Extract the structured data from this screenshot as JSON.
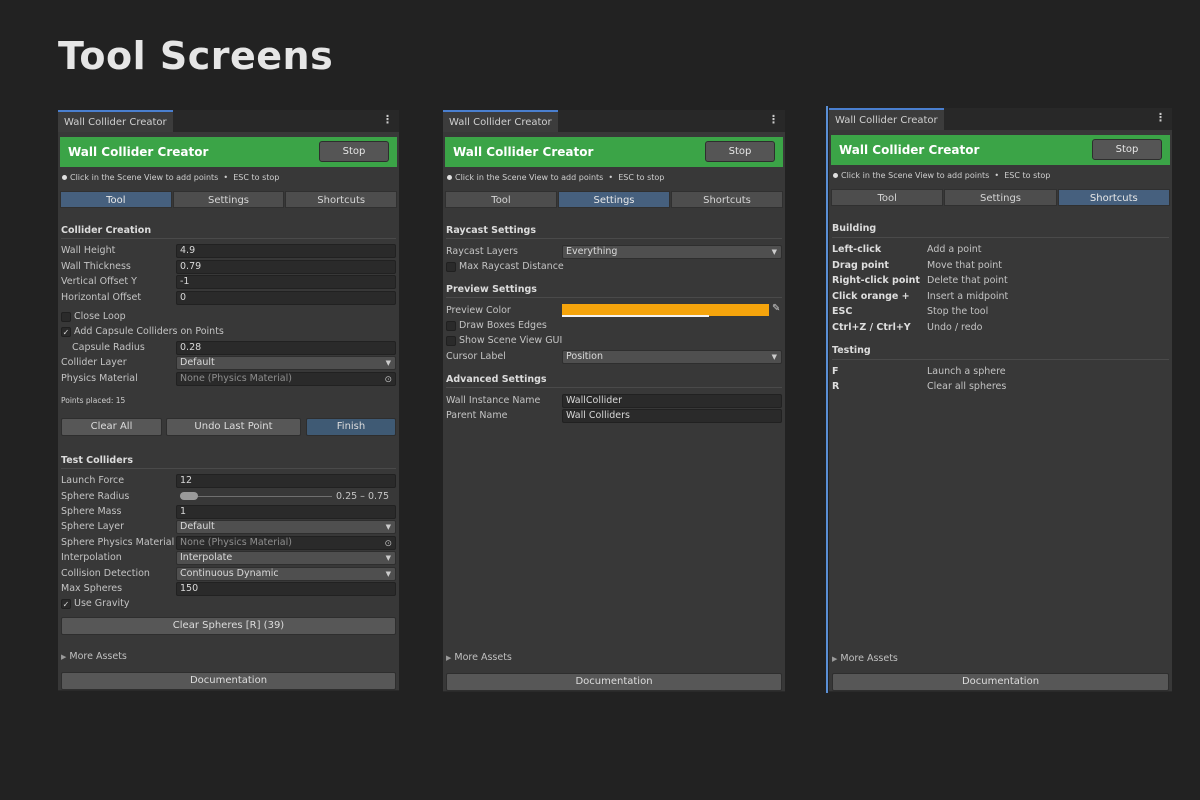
{
  "page": {
    "title": "Tool Screens"
  },
  "common": {
    "window_tab": "Wall Collider Creator",
    "header_title": "Wall Collider Creator",
    "stop_label": "Stop",
    "hint_a": "Click in the Scene View to add points",
    "hint_sep": "•",
    "hint_b": "ESC to stop",
    "tabs": [
      "Tool",
      "Settings",
      "Shortcuts"
    ],
    "more_assets": "More Assets",
    "documentation": "Documentation"
  },
  "tool": {
    "collider_creation": "Collider Creation",
    "wall_height_label": "Wall Height",
    "wall_height": "4.9",
    "wall_thickness_label": "Wall Thickness",
    "wall_thickness": "0.79",
    "vertical_offset_label": "Vertical Offset Y",
    "vertical_offset": "-1",
    "horizontal_offset_label": "Horizontal Offset",
    "horizontal_offset": "0",
    "close_loop_label": "Close Loop",
    "close_loop": false,
    "add_capsule_label": "Add Capsule Colliders on Points",
    "add_capsule": true,
    "capsule_radius_label": "Capsule Radius",
    "capsule_radius": "0.28",
    "collider_layer_label": "Collider Layer",
    "collider_layer": "Default",
    "physics_material_label": "Physics Material",
    "physics_material": "None (Physics Material)",
    "points_placed": "Points placed: 15",
    "clear_all": "Clear All",
    "undo_last": "Undo Last Point",
    "finish": "Finish",
    "test_colliders": "Test Colliders",
    "launch_force_label": "Launch Force",
    "launch_force": "12",
    "sphere_radius_label": "Sphere Radius",
    "sphere_radius": "0.25 – 0.75",
    "sphere_mass_label": "Sphere Mass",
    "sphere_mass": "1",
    "sphere_layer_label": "Sphere Layer",
    "sphere_layer": "Default",
    "sphere_material_label": "Sphere Physics Material",
    "sphere_material": "None (Physics Material)",
    "interpolation_label": "Interpolation",
    "interpolation": "Interpolate",
    "collision_label": "Collision Detection",
    "collision": "Continuous Dynamic",
    "max_spheres_label": "Max Spheres",
    "max_spheres": "150",
    "use_gravity_label": "Use Gravity",
    "use_gravity": true,
    "clear_spheres": "Clear Spheres [R] (39)"
  },
  "settings": {
    "raycast_settings": "Raycast Settings",
    "raycast_layers_label": "Raycast Layers",
    "raycast_layers": "Everything",
    "max_raycast_label": "Max Raycast Distance",
    "max_raycast": false,
    "preview_settings": "Preview Settings",
    "preview_color_label": "Preview Color",
    "preview_color": "#f5a40c",
    "draw_boxes_label": "Draw Boxes Edges",
    "draw_boxes": false,
    "show_gui_label": "Show Scene View GUI",
    "show_gui": false,
    "cursor_label_label": "Cursor Label",
    "cursor_label": "Position",
    "advanced_settings": "Advanced Settings",
    "wall_instance_label": "Wall Instance Name",
    "wall_instance": "WallCollider",
    "parent_name_label": "Parent Name",
    "parent_name": "Wall Colliders"
  },
  "shortcuts": {
    "building": "Building",
    "building_items": [
      {
        "key": "Left-click",
        "desc": "Add a point"
      },
      {
        "key": "Drag point",
        "desc": "Move that point"
      },
      {
        "key": "Right-click point",
        "desc": "Delete that point"
      },
      {
        "key": "Click orange +",
        "desc": "Insert a midpoint"
      },
      {
        "key": "ESC",
        "desc": "Stop the tool"
      },
      {
        "key": "Ctrl+Z / Ctrl+Y",
        "desc": "Undo / redo"
      }
    ],
    "testing": "Testing",
    "testing_items": [
      {
        "key": "F",
        "desc": "Launch a sphere"
      },
      {
        "key": "R",
        "desc": "Clear all spheres"
      }
    ]
  }
}
